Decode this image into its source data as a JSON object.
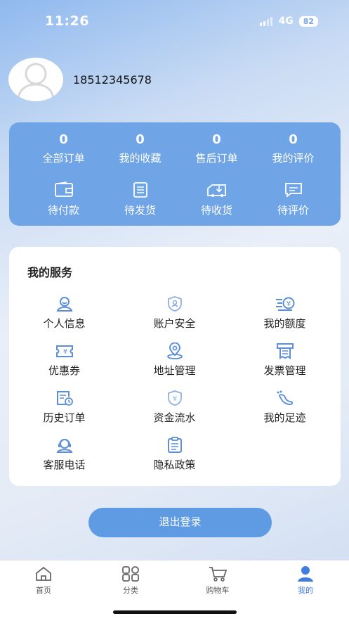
{
  "status_bar": {
    "time": "11:26",
    "network": "4G",
    "battery": "82"
  },
  "profile": {
    "phone": "18512345678"
  },
  "stats": [
    {
      "count": "0",
      "label": "全部订单"
    },
    {
      "count": "0",
      "label": "我的收藏"
    },
    {
      "count": "0",
      "label": "售后订单"
    },
    {
      "count": "0",
      "label": "我的评价"
    }
  ],
  "order_status": [
    {
      "icon": "wallet-icon",
      "label": "待付款"
    },
    {
      "icon": "package-list-icon",
      "label": "待发货"
    },
    {
      "icon": "truck-download-icon",
      "label": "待收货"
    },
    {
      "icon": "comment-icon",
      "label": "待评价"
    }
  ],
  "services": {
    "title": "我的服务",
    "items": [
      {
        "icon": "user-info-icon",
        "label": "个人信息"
      },
      {
        "icon": "account-security-icon",
        "label": "账户安全"
      },
      {
        "icon": "credit-limit-icon",
        "label": "我的额度"
      },
      {
        "icon": "coupon-icon",
        "label": "优惠券"
      },
      {
        "icon": "location-icon",
        "label": "地址管理"
      },
      {
        "icon": "invoice-icon",
        "label": "发票管理"
      },
      {
        "icon": "order-history-icon",
        "label": "历史订单"
      },
      {
        "icon": "cash-flow-icon",
        "label": "资金流水"
      },
      {
        "icon": "footprint-icon",
        "label": "我的足迹"
      },
      {
        "icon": "customer-service-icon",
        "label": "客服电话"
      },
      {
        "icon": "privacy-policy-icon",
        "label": "隐私政策"
      }
    ]
  },
  "logout_label": "退出登录",
  "tabs": [
    {
      "icon": "home-icon",
      "label": "首页"
    },
    {
      "icon": "category-icon",
      "label": "分类"
    },
    {
      "icon": "cart-icon",
      "label": "购物车"
    },
    {
      "icon": "profile-icon",
      "label": "我的",
      "active": true
    }
  ],
  "colors": {
    "accent": "#6fa4e6",
    "button": "#5e9be3",
    "active_tab": "#3f7de0"
  }
}
